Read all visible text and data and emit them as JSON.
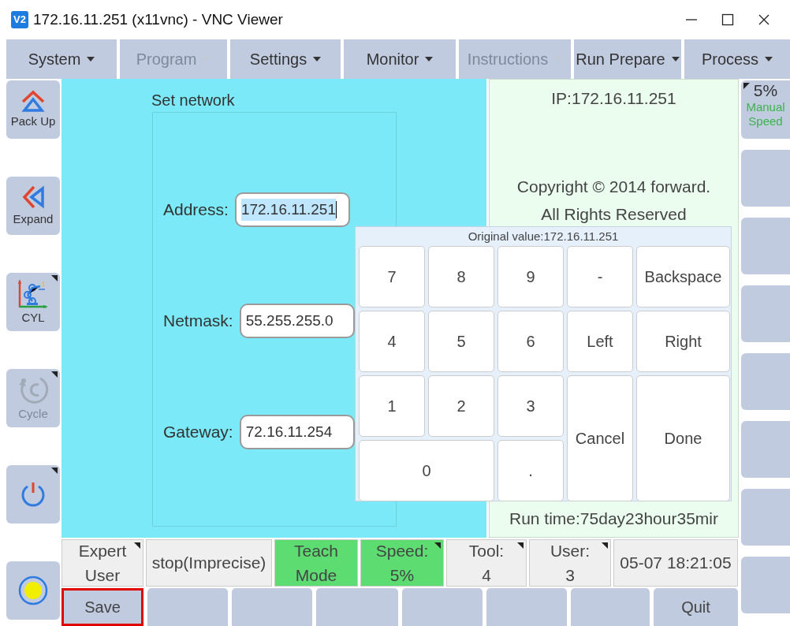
{
  "window": {
    "icon_label": "V2",
    "title": "172.16.11.251 (x11vnc) - VNC Viewer"
  },
  "menu": [
    {
      "label": "System",
      "disabled": false
    },
    {
      "label": "Program",
      "disabled": true
    },
    {
      "label": "Settings",
      "disabled": false
    },
    {
      "label": "Monitor",
      "disabled": false
    },
    {
      "label": "Instructions",
      "disabled": true
    },
    {
      "label": "Run Prepare",
      "disabled": false
    },
    {
      "label": "Process",
      "disabled": false
    }
  ],
  "left_tools": [
    {
      "kind": "pack-up",
      "label": "Pack Up",
      "disabled": false,
      "has_menu": false
    },
    {
      "kind": "expand",
      "label": "Expand",
      "disabled": false,
      "has_menu": false
    },
    {
      "kind": "cyl",
      "label": "CYL",
      "disabled": false,
      "has_menu": true
    },
    {
      "kind": "cycle",
      "label": "Cycle",
      "disabled": true,
      "has_menu": true
    },
    {
      "kind": "power",
      "disabled": false,
      "has_menu": true
    },
    {
      "kind": "lamp",
      "disabled": false,
      "has_menu": false
    }
  ],
  "form": {
    "title": "Set network",
    "fields": [
      {
        "label": "Address:",
        "value": "172.16.11.251",
        "focused": true
      },
      {
        "label": "Netmask:",
        "value": "55.255.255.0",
        "focused": false
      },
      {
        "label": "Gateway:",
        "value": "72.16.11.254",
        "focused": false
      }
    ]
  },
  "info": {
    "ip": "IP:172.16.11.251",
    "copyright": "Copyright © 2014 forward.",
    "rights": "All Rights Reserved",
    "run_time": "Run time:75day23hour35mir"
  },
  "keypad": {
    "header": "Original value:172.16.11.251",
    "keys": [
      {
        "label": "7",
        "kind": "normal"
      },
      {
        "label": "8",
        "kind": "normal"
      },
      {
        "label": "9",
        "kind": "normal"
      },
      {
        "label": "-",
        "kind": "normal"
      },
      {
        "label": "Backspace",
        "kind": "normal"
      },
      {
        "label": "4",
        "kind": "normal"
      },
      {
        "label": "5",
        "kind": "normal"
      },
      {
        "label": "6",
        "kind": "normal"
      },
      {
        "label": "Left",
        "kind": "normal"
      },
      {
        "label": "Right",
        "kind": "normal"
      },
      {
        "label": "1",
        "kind": "normal"
      },
      {
        "label": "2",
        "kind": "normal"
      },
      {
        "label": "3",
        "kind": "normal"
      },
      {
        "label": "Cancel",
        "kind": "tall"
      },
      {
        "label": "Done",
        "kind": "tall"
      },
      {
        "label": "0",
        "kind": "wide"
      },
      {
        "label": ".",
        "kind": "normal"
      }
    ]
  },
  "speed_button": {
    "value": "5%",
    "caption": "Manual Speed"
  },
  "status": [
    {
      "lines": [
        "Expert",
        "User"
      ],
      "highlighted": false,
      "has_menu": true
    },
    {
      "lines": [
        "stop(Imprecise)"
      ],
      "highlighted": false,
      "has_menu": false
    },
    {
      "lines": [
        "Teach",
        "Mode"
      ],
      "highlighted": true,
      "has_menu": false
    },
    {
      "lines": [
        "Speed:",
        "5%"
      ],
      "highlighted": true,
      "has_menu": true
    },
    {
      "lines": [
        "Tool:",
        "4"
      ],
      "highlighted": false,
      "has_menu": true
    },
    {
      "lines": [
        "User:",
        "3"
      ],
      "highlighted": false,
      "has_menu": true
    },
    {
      "lines": [
        "05-07 18:21:05"
      ],
      "highlighted": false,
      "has_menu": false
    }
  ],
  "bottom_buttons": [
    {
      "label": "Save",
      "selected": true
    },
    {
      "label": "Quit",
      "selected": false
    }
  ]
}
